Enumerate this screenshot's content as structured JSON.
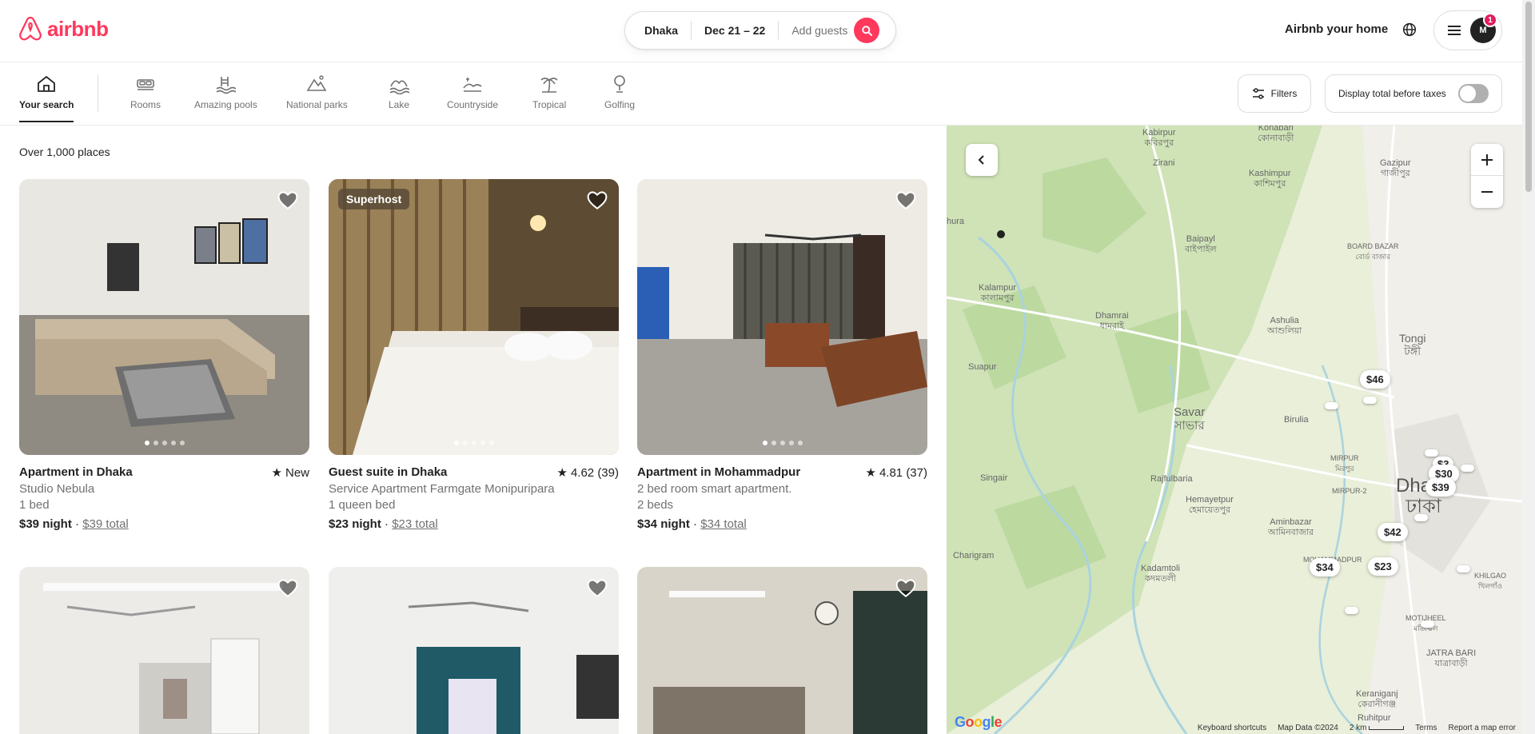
{
  "header": {
    "brand": "airbnb",
    "search": {
      "location": "Dhaka",
      "dates": "Dec 21 – 22",
      "guests": "Add guests"
    },
    "host_link": "Airbnb your home",
    "avatar_initial": "M",
    "notification_count": "1"
  },
  "categories": [
    {
      "label": "Your search",
      "icon": "house-icon",
      "active": true
    },
    {
      "label": "Rooms",
      "icon": "bed-icon"
    },
    {
      "label": "Amazing pools",
      "icon": "pool-icon"
    },
    {
      "label": "National parks",
      "icon": "park-icon"
    },
    {
      "label": "Lake",
      "icon": "lake-icon"
    },
    {
      "label": "Countryside",
      "icon": "countryside-icon"
    },
    {
      "label": "Tropical",
      "icon": "palm-icon"
    },
    {
      "label": "Golfing",
      "icon": "golf-icon"
    }
  ],
  "filters_label": "Filters",
  "taxes_toggle_label": "Display total before taxes",
  "places_count": "Over 1,000 places",
  "listings": [
    {
      "title": "Apartment in Dhaka",
      "rating": "New",
      "subtitle": "Studio Nebula",
      "beds": "1 bed",
      "price": "$39 night",
      "total": "$39 total",
      "badge": ""
    },
    {
      "title": "Guest suite in Dhaka",
      "rating": "4.62 (39)",
      "subtitle": "Service Apartment Farmgate Monipuripara",
      "beds": "1 queen bed",
      "price": "$23 night",
      "total": "$23 total",
      "badge": "Superhost"
    },
    {
      "title": "Apartment in Mohammadpur",
      "rating": "4.81 (37)",
      "subtitle": "2 bed room smart apartment.",
      "beds": "2 beds",
      "price": "$34 night",
      "total": "$34 total",
      "badge": ""
    }
  ],
  "map": {
    "labels": [
      {
        "en": "Kabirpur",
        "bn": "কবিরপুর"
      },
      {
        "en": "Konabari",
        "bn": "কোনাবাড়ী"
      },
      {
        "en": "Zirani",
        "bn": ""
      },
      {
        "en": "Kashimpur",
        "bn": "কাশিমপুর"
      },
      {
        "en": "Gazipur",
        "bn": "গাজীপুর"
      },
      {
        "en": "Baipayl",
        "bn": "বাইপাইল"
      },
      {
        "en": "BOARD BAZAR",
        "bn": "বোর্ড বাজার"
      },
      {
        "en": "hura",
        "bn": ""
      },
      {
        "en": "Kalampur",
        "bn": "কালামপুর"
      },
      {
        "en": "Dhamrai",
        "bn": "ধামরাই"
      },
      {
        "en": "Ashulia",
        "bn": "আশুলিয়া"
      },
      {
        "en": "Tongi",
        "bn": "টঙ্গী"
      },
      {
        "en": "Suapur",
        "bn": ""
      },
      {
        "en": "Savar",
        "bn": "সাভার"
      },
      {
        "en": "Birulia",
        "bn": ""
      },
      {
        "en": "MIRPUR",
        "bn": "মিরপুর"
      },
      {
        "en": "Singair",
        "bn": ""
      },
      {
        "en": "Rajfulbaria",
        "bn": ""
      },
      {
        "en": "Hemayetpur",
        "bn": "হেমায়েতপুর"
      },
      {
        "en": "MIRPUR-2",
        "bn": ""
      },
      {
        "en": "Dhaka",
        "bn": "ঢাকা"
      },
      {
        "en": "Aminbazar",
        "bn": "আমিনবাজার"
      },
      {
        "en": "Charigram",
        "bn": ""
      },
      {
        "en": "Kadamtoli",
        "bn": "কদমতলী"
      },
      {
        "en": "MOHAMMADPUR",
        "bn": ""
      },
      {
        "en": "KHILGAO",
        "bn": "খিলগাঁও"
      },
      {
        "en": "MOTIJHEEL",
        "bn": "মতিঝিল"
      },
      {
        "en": "JATRA BARI",
        "bn": "যাত্রাবাড়ী"
      },
      {
        "en": "Keraniganj",
        "bn": "কেরানীগঞ্জ"
      },
      {
        "en": "Ruhitpur",
        "bn": ""
      }
    ],
    "price_pins": [
      "$46",
      "$30",
      "$39",
      "$42",
      "$34",
      "$23",
      "$3"
    ],
    "google_logo": "Google",
    "footer": {
      "shortcuts": "Keyboard shortcuts",
      "data": "Map Data ©2024",
      "scale": "2 km",
      "terms": "Terms",
      "report": "Report a map error"
    }
  },
  "colors": {
    "brand": "#ff385c",
    "text": "#222222",
    "muted": "#717171"
  }
}
